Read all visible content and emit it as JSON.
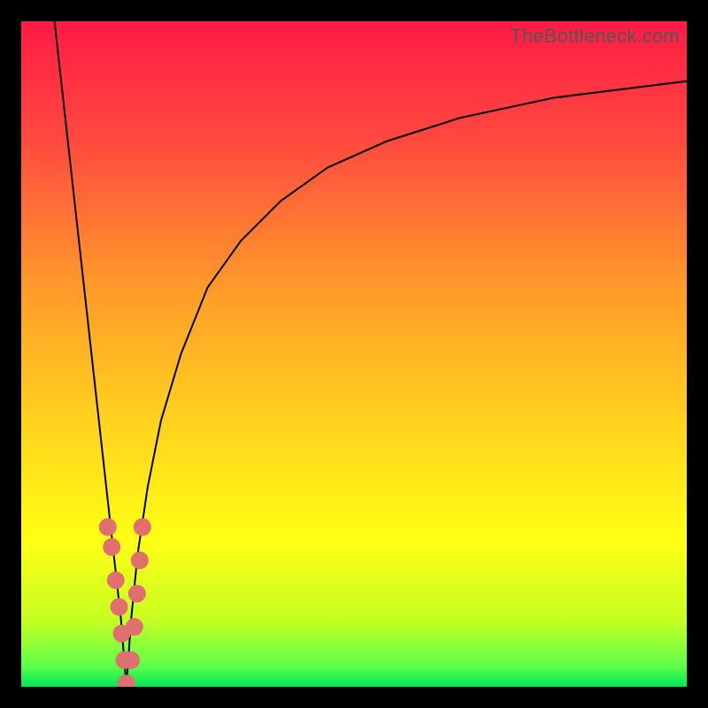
{
  "watermark": "TheBottleneck.com",
  "chart_data": {
    "type": "line",
    "title": "",
    "xlabel": "",
    "ylabel": "",
    "xlim": [
      0,
      100
    ],
    "ylim": [
      0,
      100
    ],
    "grid": false,
    "legend": false,
    "background_gradient": {
      "stops": [
        {
          "offset": 0.0,
          "color": "#ff1a46"
        },
        {
          "offset": 0.18,
          "color": "#ff4a3f"
        },
        {
          "offset": 0.4,
          "color": "#ff9a2a"
        },
        {
          "offset": 0.6,
          "color": "#ffd21d"
        },
        {
          "offset": 0.78,
          "color": "#ffff14"
        },
        {
          "offset": 0.9,
          "color": "#c6ff22"
        },
        {
          "offset": 0.97,
          "color": "#5cff4a"
        },
        {
          "offset": 1.0,
          "color": "#00e657"
        }
      ]
    },
    "series": [
      {
        "name": "left-branch",
        "x": [
          5,
          6,
          7,
          8,
          9,
          10,
          11,
          12,
          13,
          14,
          15,
          15.8
        ],
        "y": [
          100,
          91,
          82,
          73,
          64,
          55,
          46,
          37,
          28,
          19,
          10,
          0
        ]
      },
      {
        "name": "right-branch",
        "x": [
          15.8,
          16.5,
          17.5,
          19,
          21,
          24,
          28,
          33,
          39,
          46,
          55,
          66,
          80,
          100
        ],
        "y": [
          0,
          10,
          20,
          30,
          40,
          50,
          60,
          67,
          73,
          78,
          82,
          85.5,
          88.5,
          91
        ]
      }
    ],
    "scatter": {
      "name": "highlight-points",
      "color": "#e07070",
      "radius": 10,
      "points": [
        {
          "x": 13.0,
          "y": 24
        },
        {
          "x": 13.6,
          "y": 21
        },
        {
          "x": 14.2,
          "y": 16
        },
        {
          "x": 14.7,
          "y": 12
        },
        {
          "x": 15.1,
          "y": 8
        },
        {
          "x": 15.5,
          "y": 4
        },
        {
          "x": 15.8,
          "y": 0.5
        },
        {
          "x": 16.5,
          "y": 4
        },
        {
          "x": 17.0,
          "y": 9
        },
        {
          "x": 17.4,
          "y": 14
        },
        {
          "x": 17.8,
          "y": 19
        },
        {
          "x": 18.2,
          "y": 24
        }
      ]
    }
  }
}
